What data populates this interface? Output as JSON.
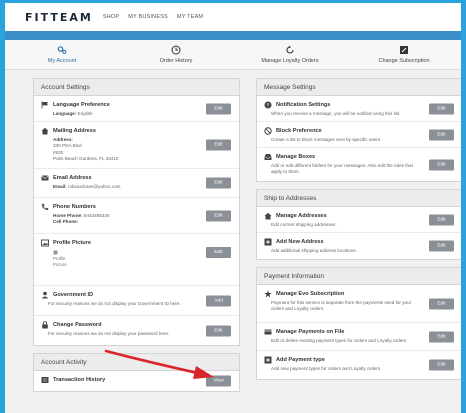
{
  "header": {
    "logo": "FITTEAM",
    "nav": [
      "SHOP",
      "MY BUSINESS",
      "MY TEAM"
    ]
  },
  "subnav": [
    {
      "label": "My Account",
      "icon": "gears-icon",
      "active": true
    },
    {
      "label": "Order History",
      "icon": "clock-icon",
      "active": false
    },
    {
      "label": "Manage Loyalty Orders",
      "icon": "refresh-icon",
      "active": false
    },
    {
      "label": "Change Subscription",
      "icon": "edit-square-icon",
      "active": false
    }
  ],
  "account_settings": {
    "title": "Account Settings",
    "language": {
      "title": "Language Preference",
      "label": "Language:",
      "value": "English",
      "button": "Edit"
    },
    "mailing": {
      "title": "Mailing Address",
      "label": "Address:",
      "line1": "330 PGA Blvd",
      "line2": "#820",
      "line3": "Palm Beach Gardens, FL 33410",
      "button": "Edit"
    },
    "email": {
      "title": "Email Address",
      "label": "Email:",
      "value": "mbeardcans@yahoo.com",
      "button": "Edit"
    },
    "phone": {
      "title": "Phone Numbers",
      "home_label": "Home Phone:",
      "home_value": "8443488326",
      "cell_label": "Cell Phone:",
      "cell_value": "",
      "button": "Edit"
    },
    "profile": {
      "title": "Profile Picture",
      "img_alt_1": "Profile",
      "img_alt_2": "Picture",
      "button": "Edit"
    },
    "gov_id": {
      "title": "Government ID",
      "desc": "For security reasons we do not display your Government ID here.",
      "button": "Add"
    },
    "password": {
      "title": "Change Password",
      "desc": "For security reasons we do not display your password here.",
      "button": "Edit"
    }
  },
  "account_activity": {
    "title": "Account Activity",
    "transaction": {
      "title": "Transaction History",
      "button": "View"
    }
  },
  "message_settings": {
    "title": "Message Settings",
    "notification": {
      "title": "Notification Settings",
      "desc": "When you receive a message, you will be notified using this list.",
      "button": "Edit"
    },
    "block": {
      "title": "Block Preference",
      "desc": "Create a list to block messages sent by specific users.",
      "button": "Edit"
    },
    "boxes": {
      "title": "Manage Boxes",
      "desc": "Add or edit different folders for your messages. Also edit the rules that apply to them.",
      "button": "Edit"
    }
  },
  "ship_to": {
    "title": "Ship to Addresses",
    "manage": {
      "title": "Manage Addresses",
      "desc": "Edit current shipping addresses.",
      "button": "Edit"
    },
    "add": {
      "title": "Add New Address",
      "desc": "Add additional shipping address locations.",
      "button": "Edit"
    }
  },
  "payment": {
    "title": "Payment Information",
    "evo": {
      "title": "Manage Evo Subscription",
      "desc": "Payment for this service is separate from the payments used for your orders and Loyalty orders.",
      "button": "Edit"
    },
    "on_file": {
      "title": "Manage Payments on File",
      "desc": "Edit or delete existing payment types for orders and Loyalty orders.",
      "button": "Edit"
    },
    "add_type": {
      "title": "Add Payment type",
      "desc": "Add new payment types for orders and Loyalty orders.",
      "button": "Edit"
    }
  },
  "colors": {
    "accent": "#2aa3dc",
    "nav_bar": "#3a8fc9",
    "button": "#8b9097",
    "arrow": "#d9262b"
  }
}
